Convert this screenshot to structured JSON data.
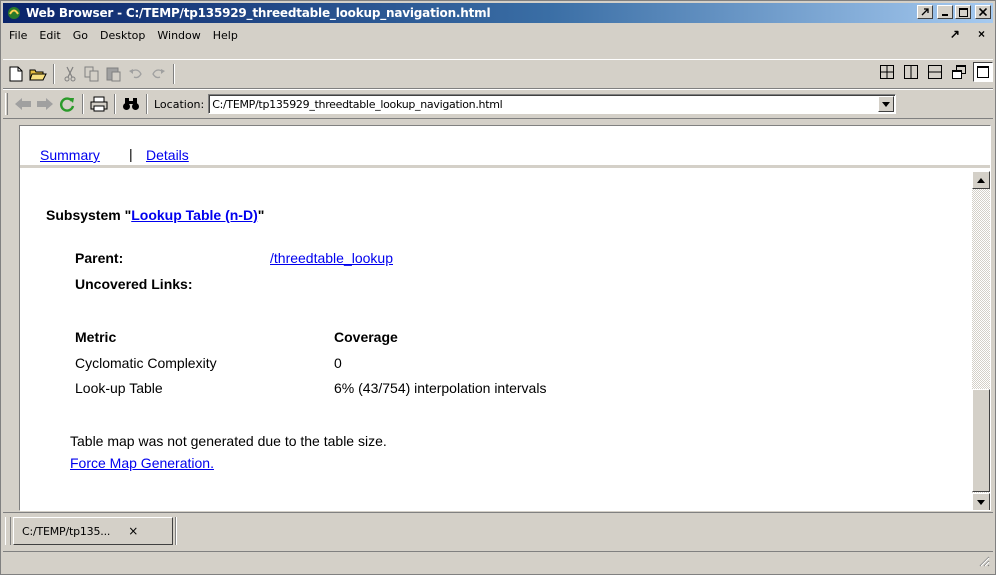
{
  "window": {
    "title": "Web Browser - C:/TEMP/tp135929_threedtable_lookup_navigation.html"
  },
  "menu": {
    "items": [
      "File",
      "Edit",
      "Go",
      "Desktop",
      "Window",
      "Help"
    ],
    "undock_glyph": "↗",
    "close_glyph": "×"
  },
  "toolbar": {
    "icons": [
      "new-page-icon",
      "open-folder-icon",
      "cut-icon",
      "copy-icon",
      "paste-icon",
      "undo-icon",
      "redo-icon"
    ],
    "layout_icons": [
      "tile-grid-icon",
      "tile-columns-icon",
      "tile-rows-icon",
      "float-icon",
      "maximize-icon"
    ]
  },
  "navbar": {
    "location_label": "Location:",
    "location_value": "C:/TEMP/tp135929_threedtable_lookup_navigation.html"
  },
  "content": {
    "tabs": {
      "summary": "Summary",
      "separator": "|",
      "details": "Details"
    },
    "subsystem": {
      "prefix": "Subsystem \"",
      "name": "Lookup Table (n-D)",
      "suffix": "\""
    },
    "parent_label": "Parent:",
    "parent_value": "/threedtable_lookup",
    "uncovered_label": "Uncovered Links:",
    "metrics": {
      "header_metric": "Metric",
      "header_coverage": "Coverage",
      "rows": [
        {
          "metric": "Cyclomatic Complexity",
          "coverage": "0"
        },
        {
          "metric": "Look-up Table",
          "coverage": "6% (43/754) interpolation intervals"
        }
      ]
    },
    "note": "Table map was not generated due to the table size.",
    "force_link": "Force Map Generation."
  },
  "bottom_tabs": [
    {
      "label": "C:/TEMP/tp135...",
      "close": "×"
    }
  ],
  "colors": {
    "link": "#0000ee",
    "chrome": "#d4d0c8",
    "title_start": "#0a246a",
    "title_end": "#a6caf0"
  }
}
